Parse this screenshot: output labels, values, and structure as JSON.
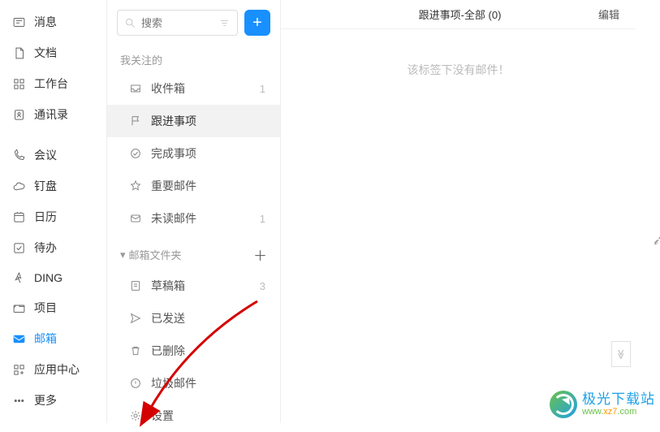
{
  "sidebar": {
    "items": [
      {
        "label": "消息",
        "icon": "message-icon"
      },
      {
        "label": "文档",
        "icon": "document-icon"
      },
      {
        "label": "工作台",
        "icon": "apps-icon"
      },
      {
        "label": "通讯录",
        "icon": "contacts-icon"
      }
    ],
    "items2": [
      {
        "label": "会议",
        "icon": "phone-icon"
      },
      {
        "label": "钉盘",
        "icon": "cloud-icon"
      },
      {
        "label": "日历",
        "icon": "calendar-icon"
      },
      {
        "label": "待办",
        "icon": "check-icon"
      },
      {
        "label": "DING",
        "icon": "ding-icon"
      },
      {
        "label": "项目",
        "icon": "project-icon"
      },
      {
        "label": "邮箱",
        "icon": "mail-icon",
        "active": true
      },
      {
        "label": "应用中心",
        "icon": "app-center-icon"
      },
      {
        "label": "更多",
        "icon": "more-icon"
      }
    ]
  },
  "search": {
    "placeholder": "搜索"
  },
  "compose_label": "+",
  "section_followed": {
    "title": "我关注的"
  },
  "section_folders": {
    "title": "邮箱文件夹",
    "add": "＋"
  },
  "followed": [
    {
      "label": "收件箱",
      "count": "1"
    },
    {
      "label": "跟进事项",
      "active": true
    },
    {
      "label": "完成事项"
    },
    {
      "label": "重要邮件"
    },
    {
      "label": "未读邮件",
      "count": "1"
    }
  ],
  "folders": [
    {
      "label": "草稿箱",
      "count": "3"
    },
    {
      "label": "已发送"
    },
    {
      "label": "已删除"
    },
    {
      "label": "垃圾邮件"
    }
  ],
  "settings_label": "设置",
  "main": {
    "title": "跟进事项-全部 (0)",
    "edit": "编辑",
    "empty": "该标签下没有邮件！"
  },
  "watermark": {
    "name": "极光下载站",
    "url_pre": "www.",
    "url_mid": "xz7",
    "url_post": ".com"
  },
  "scroll_glyph": "≫"
}
